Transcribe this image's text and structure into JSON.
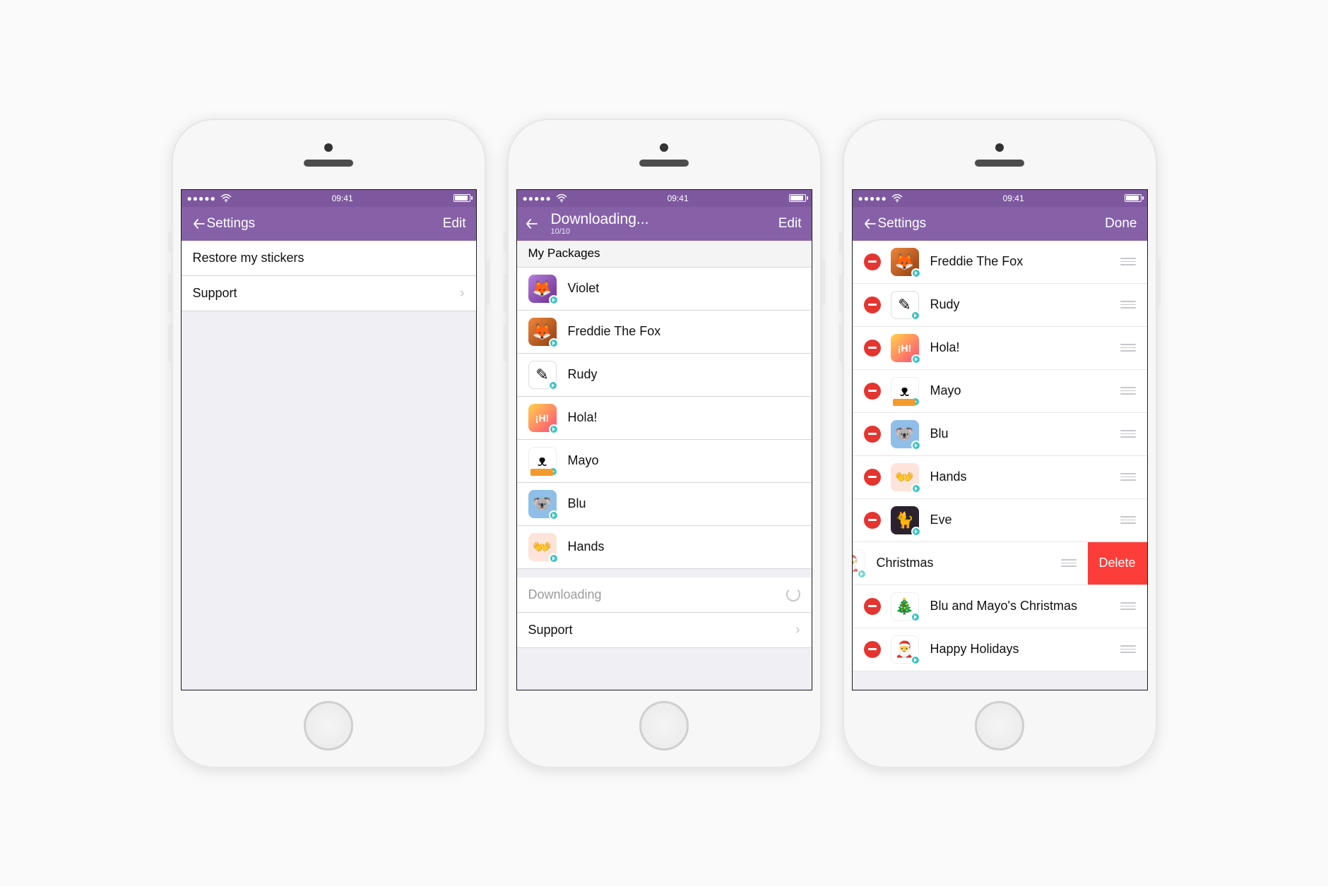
{
  "status": {
    "time": "09:41"
  },
  "colors": {
    "brand": "#8661a8",
    "statusbar": "#7d589e",
    "delete": "#fc3d39",
    "minus": "#e53530"
  },
  "screen1": {
    "nav": {
      "title": "Settings",
      "right": "Edit"
    },
    "items": [
      {
        "label": "Restore my stickers"
      },
      {
        "label": "Support",
        "chevron": true
      }
    ]
  },
  "screen2": {
    "nav": {
      "title": "Downloading...",
      "subtitle": "10/10",
      "right": "Edit"
    },
    "section_header": "My Packages",
    "packages": [
      {
        "name": "Violet",
        "avatar": "av-violet",
        "glyph": "🦊"
      },
      {
        "name": "Freddie The Fox",
        "avatar": "av-fox",
        "glyph": "🦊"
      },
      {
        "name": "Rudy",
        "avatar": "av-rudy",
        "glyph": "✎"
      },
      {
        "name": "Hola!",
        "avatar": "av-hola",
        "glyph": "¡H!"
      },
      {
        "name": "Mayo",
        "avatar": "av-mayo",
        "glyph": "ᴥ"
      },
      {
        "name": "Blu",
        "avatar": "av-blu",
        "glyph": "🐨"
      },
      {
        "name": "Hands",
        "avatar": "av-hands",
        "glyph": "👐"
      }
    ],
    "footer": {
      "downloading": "Downloading",
      "support": "Support"
    }
  },
  "screen3": {
    "nav": {
      "title": "Settings",
      "right": "Done"
    },
    "packages": [
      {
        "name": "Freddie The Fox",
        "avatar": "av-fox",
        "glyph": "🦊"
      },
      {
        "name": "Rudy",
        "avatar": "av-rudy",
        "glyph": "✎"
      },
      {
        "name": "Hola!",
        "avatar": "av-hola",
        "glyph": "¡H!"
      },
      {
        "name": "Mayo",
        "avatar": "av-mayo",
        "glyph": "ᴥ"
      },
      {
        "name": "Blu",
        "avatar": "av-blu",
        "glyph": "🐨"
      },
      {
        "name": "Hands",
        "avatar": "av-hands",
        "glyph": "👐"
      },
      {
        "name": "Eve",
        "avatar": "av-eve",
        "glyph": "🐈"
      },
      {
        "name": "Christmas",
        "avatar": "av-xmas",
        "glyph": "🎅",
        "swiped": true
      },
      {
        "name": "Blu and Mayo's Christmas",
        "avatar": "av-blumayo",
        "glyph": "🎄"
      },
      {
        "name": "Happy Holidays",
        "avatar": "av-santa",
        "glyph": "🎅"
      }
    ],
    "delete_label": "Delete"
  }
}
